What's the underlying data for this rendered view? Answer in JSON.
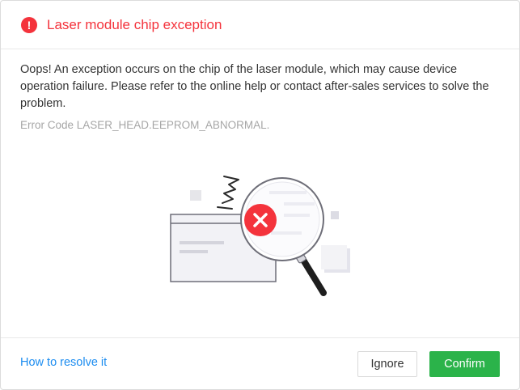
{
  "dialog": {
    "title": "Laser module chip exception",
    "alert_icon_glyph": "!",
    "message": "Oops! An exception occurs on the chip of the laser module, which may cause device operation failure. Please refer to the online help or contact after-sales services to solve the problem.",
    "error_code": "Error Code LASER_HEAD.EEPROM_ABNORMAL."
  },
  "footer": {
    "help_link": "How to resolve it",
    "ignore_label": "Ignore",
    "confirm_label": "Confirm"
  },
  "colors": {
    "error_red": "#f4333c",
    "link_blue": "#1b8cf0",
    "confirm_green": "#2bb34a",
    "muted_gray": "#a6a6a6"
  },
  "icons": [
    "exclamation-circle-icon",
    "magnifier-error-illustration"
  ]
}
